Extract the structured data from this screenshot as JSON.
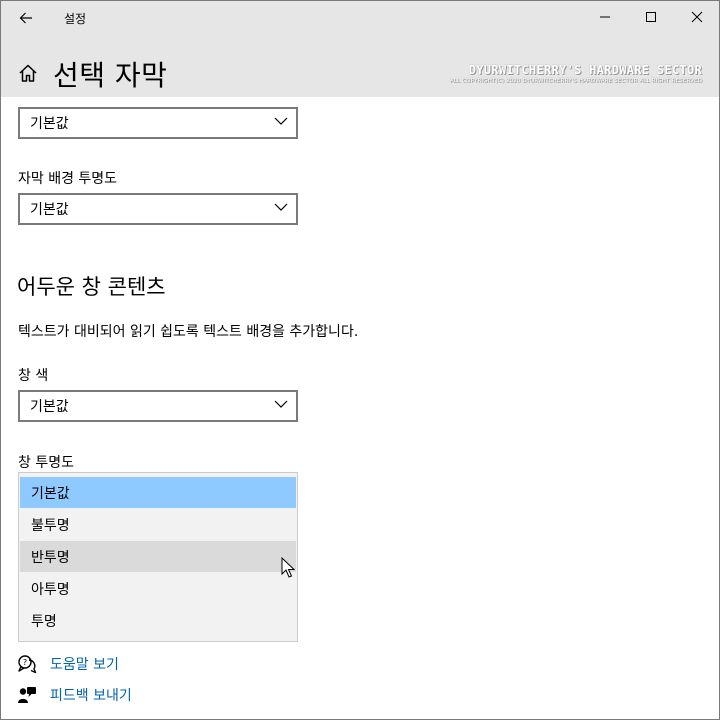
{
  "window": {
    "title": "설정",
    "controls": {
      "minimize": "minimize-icon",
      "maximize": "maximize-icon",
      "close": "close-icon"
    }
  },
  "header": {
    "page_title": "선택 자막",
    "home_icon": "home-icon",
    "back_icon": "back-arrow-icon",
    "watermark": {
      "main": "DYURWITCHERRY'S HARDWARE SECTOR",
      "sub": "ALL COPYRIGHT(C) 2020 DYURWITCHERRY'S HARDWARE SECTOR ALL RIGHT RESERVED"
    }
  },
  "fields": {
    "top_select": {
      "value": "기본값"
    },
    "bg_opacity": {
      "label": "자막 배경 투명도",
      "value": "기본값"
    },
    "window_color": {
      "label": "창 색",
      "value": "기본값"
    },
    "window_opacity": {
      "label": "창 투명도"
    }
  },
  "section": {
    "heading": "어두운 창 콘텐츠",
    "description": "텍스트가 대비되어 읽기 쉽도록 텍스트 배경을 추가합니다."
  },
  "dropdown": {
    "options": [
      "기본값",
      "불투명",
      "반투명",
      "아투명",
      "투명"
    ],
    "selected": "기본값",
    "hovered": "반투명"
  },
  "links": {
    "help": "도움말 보기",
    "feedback": "피드백 보내기"
  },
  "colors": {
    "titlebar": "#e6e6e6",
    "selected_option": "#8ec9ff",
    "hover_option": "#dadada",
    "link": "#0063b1",
    "dropdown_bg": "#f2f2f2"
  }
}
